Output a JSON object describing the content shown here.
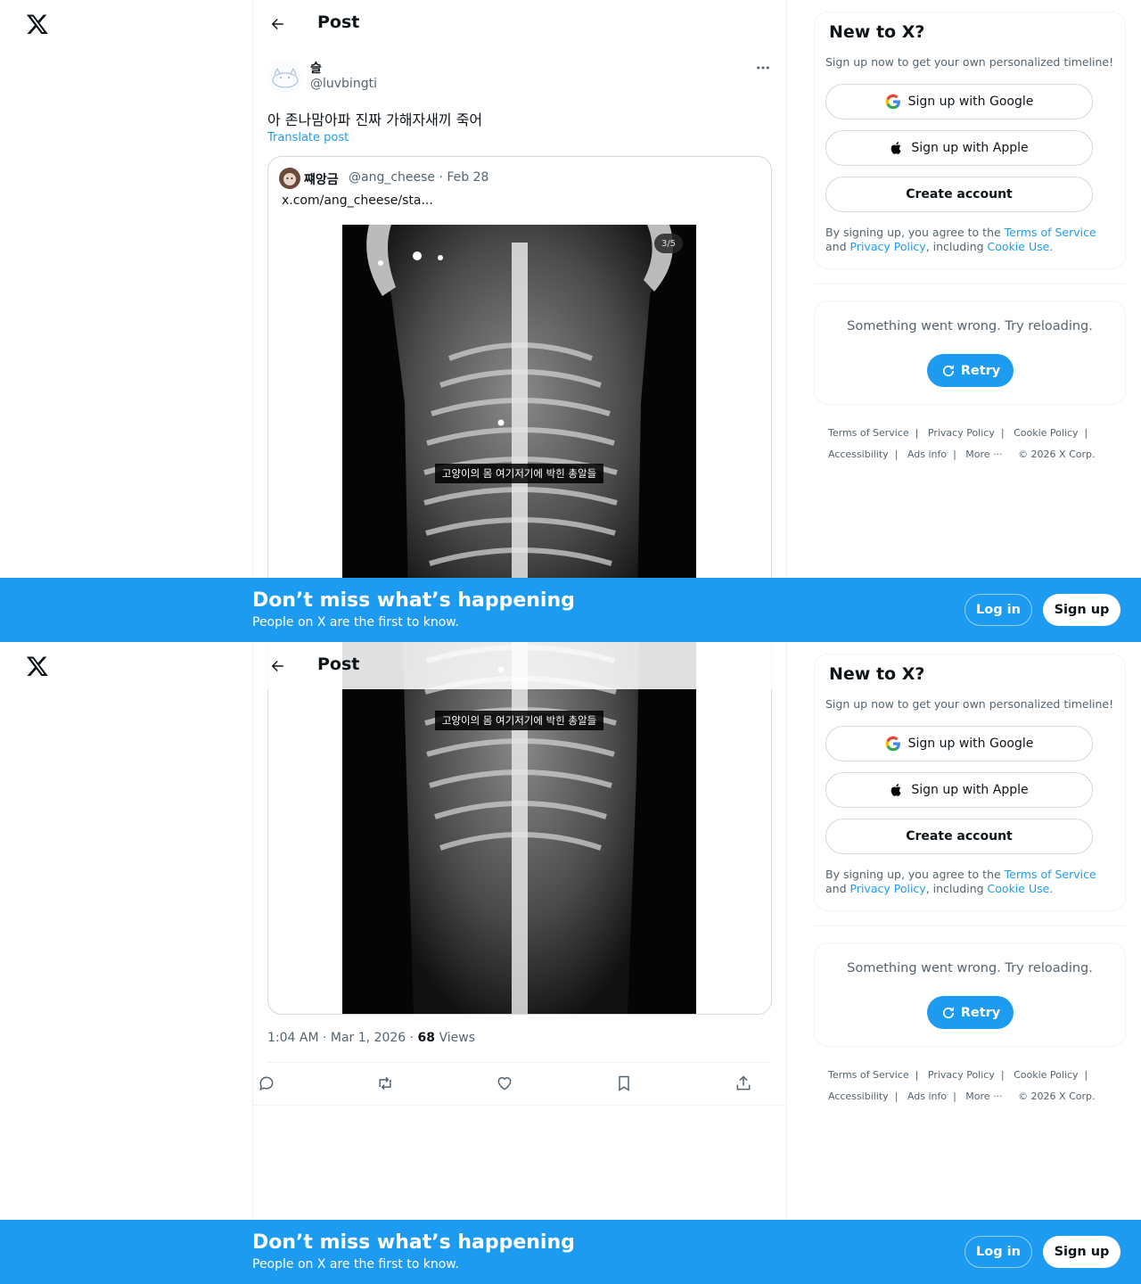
{
  "header": {
    "title": "Post"
  },
  "tweet": {
    "author_name": "슬",
    "author_handle": "@luvbingti",
    "text": "아 존나맘아파 진짜 가해자새끼 죽어",
    "translate": "Translate post",
    "timestamp": "1:04 AM · Mar 1, 2026 · ",
    "views_count": "68",
    "views_label": "Views"
  },
  "quote": {
    "author_name": "쨰앙금",
    "meta": "@ang_cheese · Feb 28",
    "text": "x.com/ang_cheese/sta...",
    "media_counter": "3/5",
    "media_caption": "고양이의 몸 여기저기에 박힌 총알들"
  },
  "sidebar": {
    "title": "New to X?",
    "subtitle": "Sign up now to get your own personalized timeline!",
    "google_label": "Sign up with Google",
    "apple_label": "Sign up with Apple",
    "create_label": "Create account",
    "terms_pre": "By signing up, you agree to the ",
    "terms_link": "Terms of Service",
    "terms_and": " and ",
    "privacy_link": "Privacy Policy",
    "terms_mid": ", including ",
    "cookie_link": "Cookie Use",
    "terms_end": ".",
    "error_text": "Something went wrong. Try reloading.",
    "retry_label": "Retry"
  },
  "footer": {
    "terms": "Terms of Service",
    "privacy": "Privacy Policy",
    "cookie": "Cookie Policy",
    "accessibility": "Accessibility",
    "ads": "Ads info",
    "more": "More ···",
    "copyright": "© 2026 X Corp."
  },
  "banner": {
    "title": "Don’t miss what’s happening",
    "subtitle": "People on X are the first to know.",
    "login_label": "Log in",
    "signup_label": "Sign up"
  },
  "colors": {
    "accent": "#1d9bf0",
    "text": "#0f1419",
    "muted": "#536471",
    "border": "#cfd9de"
  },
  "icons": [
    "x-logo-icon",
    "back-arrow-icon",
    "more-dots-icon",
    "google-icon",
    "apple-icon",
    "retry-icon",
    "reply-icon",
    "repost-icon",
    "like-icon",
    "bookmark-icon",
    "share-icon"
  ]
}
